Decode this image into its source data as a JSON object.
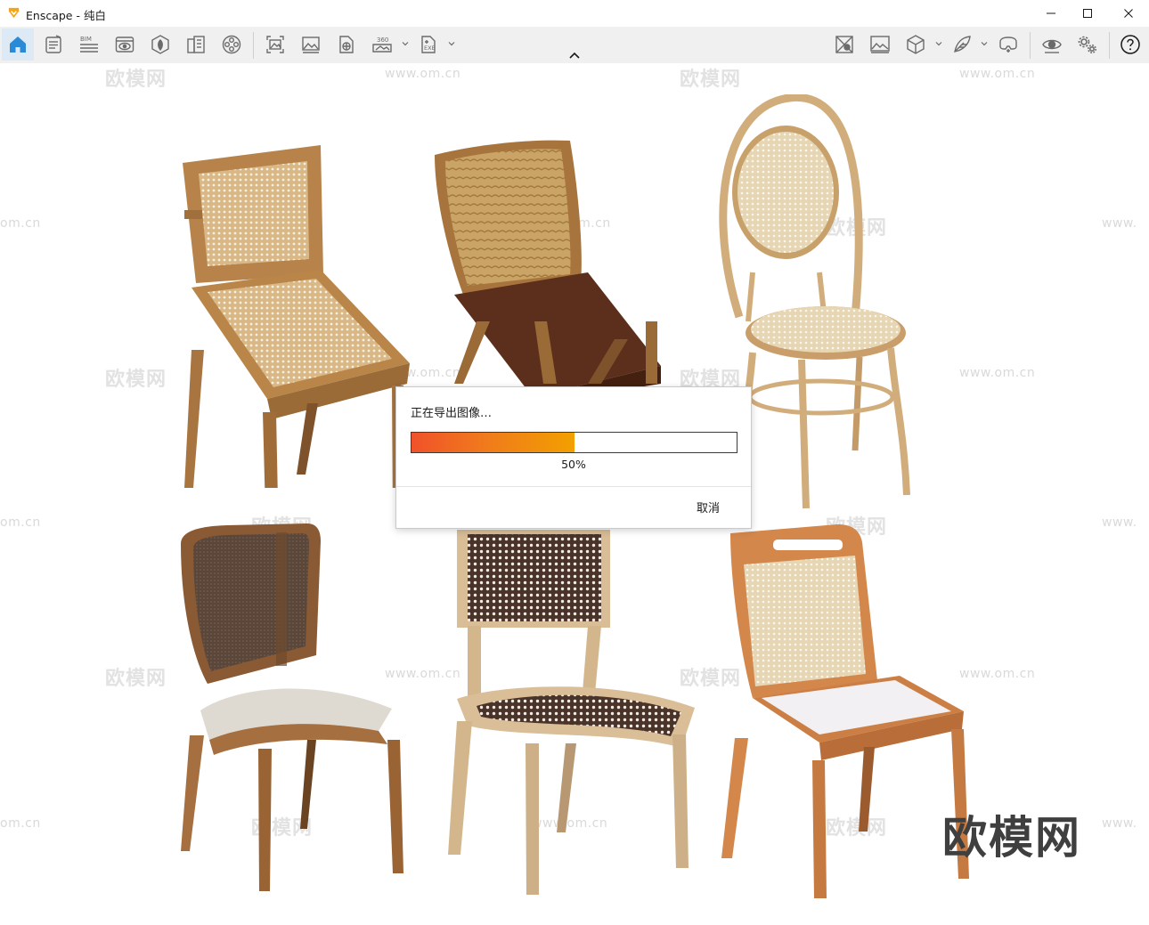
{
  "window": {
    "title": "Enscape - 纯白"
  },
  "toolbar": {
    "buttons": [
      {
        "icon": "home-icon",
        "active": true
      },
      {
        "icon": "document-icon"
      },
      {
        "icon": "bim-icon",
        "label": "BIM"
      },
      {
        "icon": "visual-settings-icon"
      },
      {
        "icon": "asset-library-icon"
      },
      {
        "icon": "material-editor-icon"
      },
      {
        "icon": "video-editor-icon"
      },
      {
        "icon": "screenshot-icon"
      },
      {
        "icon": "batch-render-icon"
      },
      {
        "icon": "web-standalone-icon"
      },
      {
        "icon": "panorama-360-icon",
        "label": "360"
      },
      {
        "icon": "export-exe-icon",
        "label": "EXE"
      },
      {
        "icon": "collaboration-icon"
      },
      {
        "icon": "gallery-icon"
      },
      {
        "icon": "cube-view-icon"
      },
      {
        "icon": "feather-icon"
      },
      {
        "icon": "vr-headset-icon"
      },
      {
        "icon": "view-eye-icon"
      },
      {
        "icon": "settings-gears-icon"
      },
      {
        "icon": "help-icon"
      }
    ]
  },
  "watermarks": {
    "site": "www.om.cn",
    "site_partial": "om.cn",
    "site_left": "www.",
    "brand": "欧模网"
  },
  "dialog": {
    "title": "正在导出图像…",
    "progress_percent": 50,
    "progress_label": "50%",
    "cancel_label": "取消"
  },
  "colors": {
    "accent": "#2b8ad6",
    "progress_start": "#f0522a",
    "progress_end": "#f2a000"
  }
}
